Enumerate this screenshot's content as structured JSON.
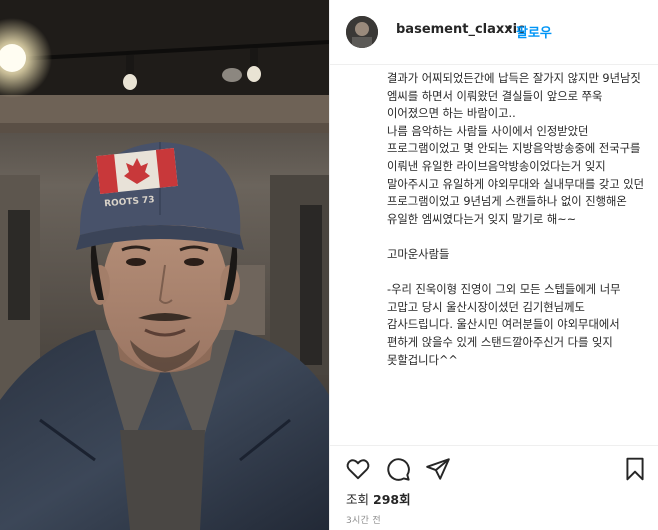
{
  "post": {
    "username": "basement_claxxic",
    "separator": "•",
    "follow_label": "팔로우",
    "caption": "결과가 어찌되었든간에 납득은 잘가지 않지만 9년남짓 엠씨를 하면서 이뤄왔던 결실들이 앞으로 쭈욱 이어졌으면 하는 바람이고..\n나름 음악하는 사람들 사이에서 인정받았던 프로그램이었고 몇 안되는 지방음악방송중에 전국구를 이뤄낸 유일한 라이브음악방송이었다는거 잊지 말아주시고 유일하게 야외무대와 실내무대를 갖고 있던 프로그램이었고 9년넘게 스캔들하나 없이 진행해온 유일한 엠씨였다는거 잊지 말기로 해~~\n\n고마운사람들\n\n-우리 진욱이형 진영이 그외 모든 스텝들에게 너무 고맙고 당시 울산시장이셨던 김기현님께도 감사드립니다. 울산시민 여러분들이 야외무대에서 편하게 앉을수 있게 스탠드깔아주신거 다를 잊지 못할겁니다^^",
    "views_label": "조회",
    "views_count": "298회",
    "time_ago": "3시간 전"
  },
  "photo": {
    "cap_text": "ROOTS 73",
    "cap_flag": "canada-flag-icon"
  },
  "icons": {
    "like": "heart-icon",
    "comment": "comment-icon",
    "share": "paper-plane-icon",
    "save": "bookmark-icon"
  },
  "colors": {
    "follow": "#0095f6",
    "text": "#262626",
    "muted": "#8e8e8e",
    "border": "#efefef"
  }
}
